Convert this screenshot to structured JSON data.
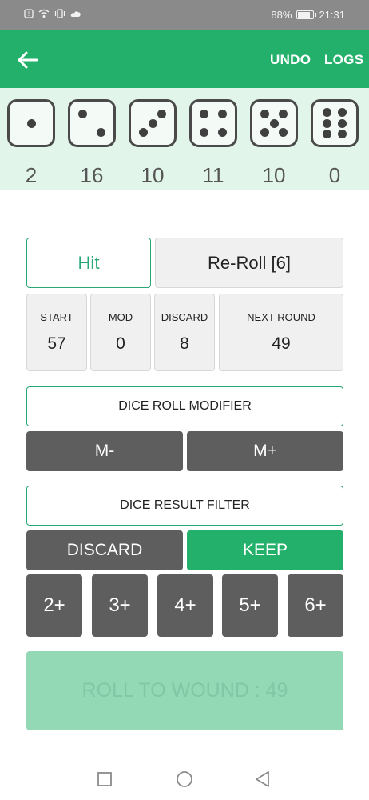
{
  "status_bar": {
    "battery": "88%",
    "time": "21:31"
  },
  "app_bar": {
    "undo_label": "UNDO",
    "logs_label": "LOGS",
    "back_icon": "arrow-left-icon"
  },
  "dice": [
    {
      "face": 1,
      "count": "2"
    },
    {
      "face": 2,
      "count": "16"
    },
    {
      "face": 3,
      "count": "10"
    },
    {
      "face": 4,
      "count": "11"
    },
    {
      "face": 5,
      "count": "10"
    },
    {
      "face": 6,
      "count": "0"
    }
  ],
  "actions": {
    "hit_label": "Hit",
    "reroll_label": "Re-Roll [6]"
  },
  "stats": [
    {
      "label": "START",
      "value": "57"
    },
    {
      "label": "MOD",
      "value": "0"
    },
    {
      "label": "DISCARD",
      "value": "8"
    },
    {
      "label": "NEXT ROUND",
      "value": "49"
    }
  ],
  "modifier": {
    "title": "DICE ROLL MODIFIER",
    "minus_label": "M-",
    "plus_label": "M+"
  },
  "filter": {
    "title": "DICE RESULT FILTER",
    "discard_label": "DISCARD",
    "keep_label": "KEEP",
    "thresholds": [
      "2+",
      "3+",
      "4+",
      "5+",
      "6+"
    ]
  },
  "roll_button": {
    "label": "ROLL TO WOUND : 49"
  },
  "colors": {
    "accent": "#23b06b",
    "dice_bg": "#e1f5ea",
    "dark_button": "#5e5e5e",
    "disabled_roll": "#93d9b6"
  }
}
